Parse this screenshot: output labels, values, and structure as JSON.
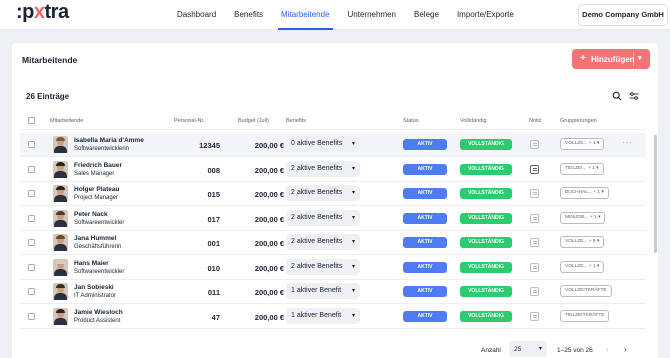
{
  "app": {
    "logo_prefix": ":p",
    "logo_x": "x",
    "logo_suffix": "tra"
  },
  "nav": [
    "Dashboard",
    "Benefits",
    "Mitarbeitende",
    "Unternehmen",
    "Belege",
    "Importe/Exporte"
  ],
  "nav_active": "Mitarbeitende",
  "company": "Demo Company GmbH",
  "page": {
    "title": "Mitarbeitende",
    "add_label": "Hinzufügen",
    "count": "26 Einträge"
  },
  "columns": {
    "employee": "Mitarbeitende",
    "pnr": "Personal-Nr.",
    "budget": "Budget (Juli)",
    "benefits": "Benefits",
    "status": "Status",
    "complete": "Vollständig",
    "note": "Notiz",
    "groups": "Gruppierungen"
  },
  "rows": [
    {
      "name": "Isabella Maria d'Amme",
      "role": "Softwareentwicklerin",
      "pnr": "12345",
      "budget": "200,00 €",
      "benefits": "0 aktive Benefits",
      "status": "AKTIV",
      "complete": "VOLLSTÄNDIG",
      "group": "VOLLZE... + 1"
    },
    {
      "name": "Friedrich Bauer",
      "role": "Sales Manager",
      "pnr": "008",
      "budget": "200,00 €",
      "benefits": "2 aktive Benefits",
      "status": "AKTIV",
      "complete": "VOLLSTÄNDIG",
      "group": "TEILZEI... + 1"
    },
    {
      "name": "Holger Plateau",
      "role": "Project Manager",
      "pnr": "015",
      "budget": "200,00 €",
      "benefits": "2 aktive Benefits",
      "status": "AKTIV",
      "complete": "VOLLSTÄNDIG",
      "group": "BUCHHAL... + 1"
    },
    {
      "name": "Peter Nack",
      "role": "Softwareentwickler",
      "pnr": "017",
      "budget": "200,00 €",
      "benefits": "2 aktive Benefits",
      "status": "AKTIV",
      "complete": "VOLLSTÄNDIG",
      "group": "MINIJOB... + 1"
    },
    {
      "name": "Jana Hummel",
      "role": "Geschäftsführerin",
      "pnr": "001",
      "budget": "200,00 €",
      "benefits": "2 aktive Benefits",
      "status": "AKTIV",
      "complete": "VOLLSTÄNDIG",
      "group": "VOLLZE... + 9"
    },
    {
      "name": "Hans Maier",
      "role": "Softwareentwickler",
      "pnr": "010",
      "budget": "200,00 €",
      "benefits": "2 aktive Benefits",
      "status": "AKTIV",
      "complete": "VOLLSTÄNDIG",
      "group": "VOLLZE... + 1"
    },
    {
      "name": "Jan Sobieski",
      "role": "IT Administrator",
      "pnr": "011",
      "budget": "200,00 €",
      "benefits": "1 aktiver Benefit",
      "status": "AKTIV",
      "complete": "VOLLSTÄNDIG",
      "group": "VOLLZEITKRÄFTE"
    },
    {
      "name": "Jamie Wiesloch",
      "role": "Product Assistent",
      "pnr": "47",
      "budget": "200,00 €",
      "benefits": "1 aktiver Benefit",
      "status": "AKTIV",
      "complete": "VOLLSTÄNDIG",
      "group": "TEILZEITKRÄFTE"
    }
  ],
  "footer": {
    "count_label": "Anzahl",
    "page_size": "25",
    "range": "1–25 von 26"
  },
  "colors": {
    "accent": "#2d5bff",
    "status": "#4d7cf5",
    "complete": "#2bcb6e",
    "add_button": "#f27474"
  }
}
